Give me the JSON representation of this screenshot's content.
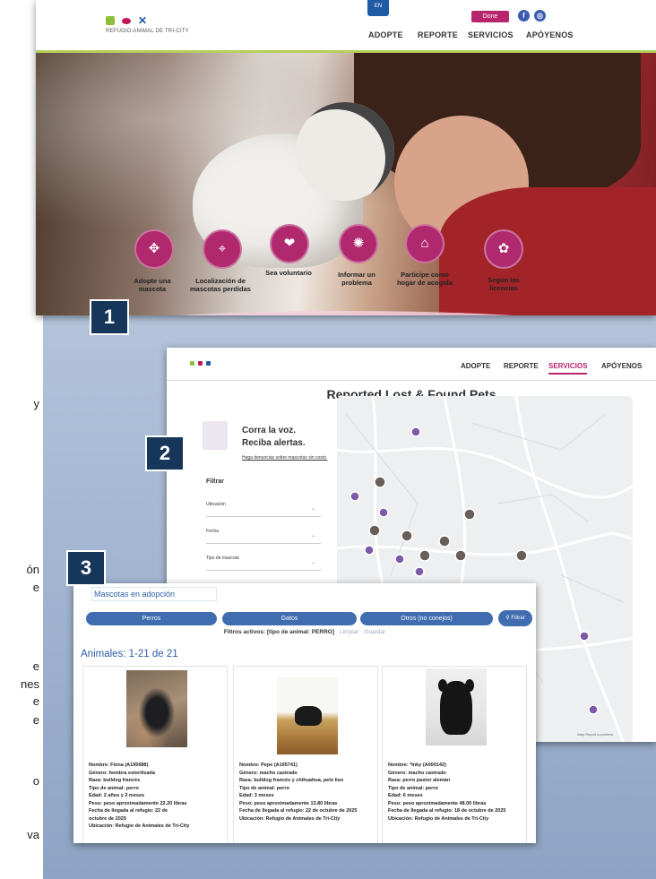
{
  "side_text": [
    "y",
    "ón",
    "e",
    "e",
    "nes",
    "e",
    "e",
    "o",
    "va"
  ],
  "badges": [
    "1",
    "2",
    "3"
  ],
  "shot1": {
    "logo_text": "REFUGIO ANIMAL DE TRI-CITY",
    "lang_tab": "EN",
    "done_label": "Done",
    "nav": [
      "ADOPTE",
      "REPORTE",
      "SERVICIOS",
      "APÓYENOS"
    ],
    "services": [
      {
        "icon": "paw-hand-icon",
        "label_1": "Adopte una",
        "label_2": "mascota"
      },
      {
        "icon": "map-search-icon",
        "label_1": "Localización de",
        "label_2": "mascotas perdidas"
      },
      {
        "icon": "heart-hand-icon",
        "label_1": "Sea voluntario",
        "label_2": ""
      },
      {
        "icon": "paw-alert-icon",
        "label_1": "Informar un",
        "label_2": "problema"
      },
      {
        "icon": "home-heart-icon",
        "label_1": "Participe como",
        "label_2": "hogar de acogida"
      },
      {
        "icon": "dog-license-icon",
        "label_1": "Según las",
        "label_2": "licencias"
      }
    ]
  },
  "shot2": {
    "nav": [
      "ADOPTE",
      "REPORTE",
      "SERVICIOS",
      "APÓYENOS"
    ],
    "active_nav": "SERVICIOS",
    "title": "Reported Lost & Found Pets",
    "promo_line1": "Corra la voz.",
    "promo_line2": "Reciba alertas.",
    "promo_link": "Haga denuncias sobre mascotas sin costo.",
    "filter_heading": "Filtrar",
    "filters": [
      "Ubicación",
      "Fecha",
      "Tipo de mascota"
    ],
    "map_attribution": "Map   Report a problem"
  },
  "shot3": {
    "title": "Mascotas en adopción",
    "tabs": [
      "Perros",
      "Gatos",
      "Otros (no conejos)"
    ],
    "filter_button": "Filtrar",
    "active_filters": "Filtros activos: [tipo de animal: PERRO]",
    "link_1": "Limpiar",
    "link_2": "Guardar",
    "count": "Animales: 1-21 de 21",
    "animals": [
      {
        "lines": [
          "Nombre: Fiona (A195688)",
          "Género: hembra esterilizada",
          "Raza: bulldog francés",
          "Tipo de animal: perro",
          "Edad: 2 años y 2 meses",
          "Peso: peso aproximadamente 22.20 libras",
          "Fecha de llegada al refugio: 22 de",
          "octubre de 2025",
          "Ubicación: Refugio de Animales de Tri-City"
        ]
      },
      {
        "lines": [
          "Nombre: Pepe (A195741)",
          "Género: macho castrado",
          "Raza: bulldog francés y chihuahua, pelo liso",
          "Tipo de animal: perro",
          "Edad: 3 meses",
          "Peso: peso aproximadamente 13.80 libras",
          "Fecha de llegada al refugio: 22 de octubre de 2025",
          "Ubicación: Refugio de Animales de Tri-City"
        ]
      },
      {
        "lines": [
          "Nombre: *Inky (A000142)",
          "Género: macho castrado",
          "Raza: perro pastor alemán",
          "Tipo de animal: perro",
          "Edad: 6 meses",
          "Peso: peso aproximadamente 48.00 libras",
          "Fecha de llegada al refugio: 18 de octubre de 2025",
          "Ubicación: Refugio de Animales de Tri-City"
        ]
      }
    ]
  },
  "colors": {
    "brand_magenta": "#b8256d",
    "brand_blue": "#3f6db0",
    "navy_badge": "#16365a",
    "lime_rule": "#b6cf5c"
  }
}
